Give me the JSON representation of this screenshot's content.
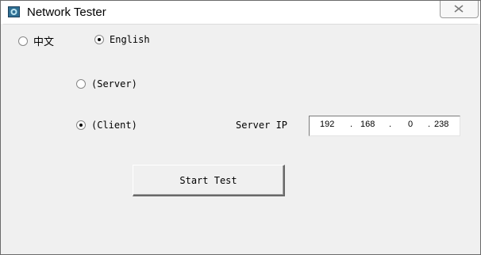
{
  "window": {
    "title": "Network Tester",
    "icon": "app-icon"
  },
  "language": {
    "options": [
      {
        "label": "中文",
        "selected": false
      },
      {
        "label": "English",
        "selected": true
      }
    ]
  },
  "mode": {
    "server": {
      "label": "(Server)",
      "selected": false
    },
    "client": {
      "label": "(Client)",
      "selected": true
    }
  },
  "server_ip": {
    "label": "Server IP",
    "octets": [
      "192",
      "168",
      "0",
      "238"
    ],
    "separator": "."
  },
  "start_button": {
    "label": "Start Test"
  }
}
